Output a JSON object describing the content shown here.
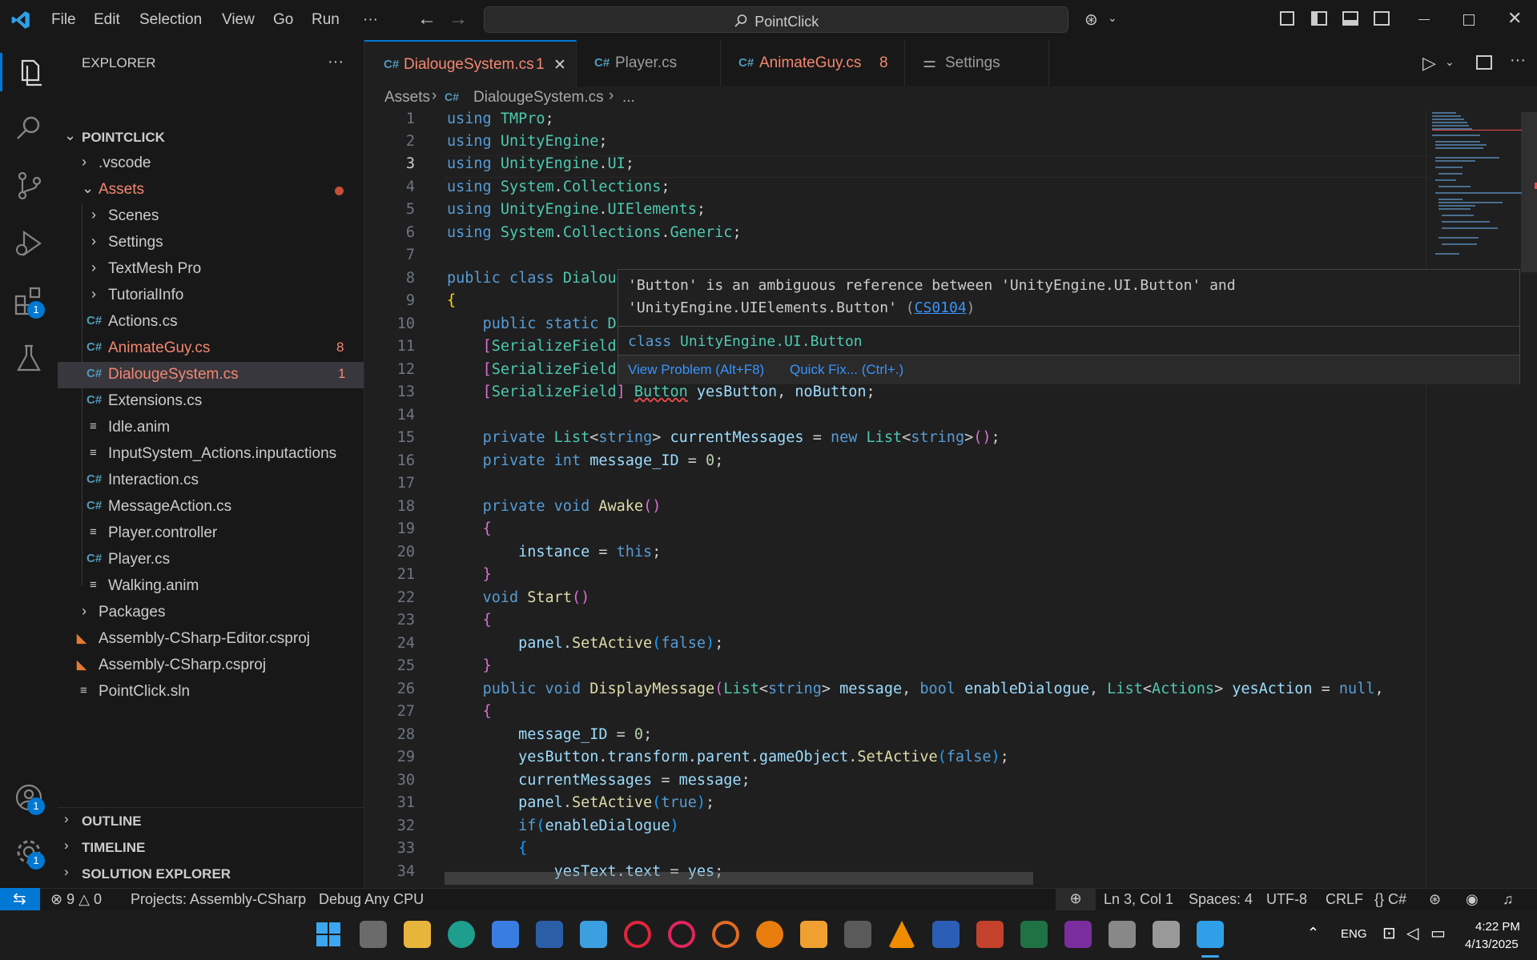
{
  "titlebar": {
    "menu": [
      "File",
      "Edit",
      "Selection",
      "View",
      "Go",
      "Run",
      "···"
    ],
    "search_text": "PointClick"
  },
  "activitybar": {
    "extensions_badge": "1",
    "accounts_badge": "1",
    "manage_badge": "1"
  },
  "explorer": {
    "title": "EXPLORER",
    "more": "···",
    "root": "POINTCLICK",
    "items": [
      {
        "label": ".vscode"
      },
      {
        "label": "Assets"
      },
      {
        "label": "Scenes"
      },
      {
        "label": "Settings"
      },
      {
        "label": "TextMesh Pro"
      },
      {
        "label": "TutorialInfo"
      },
      {
        "label": "Actions.cs"
      },
      {
        "label": "AnimateGuy.cs",
        "count": "8"
      },
      {
        "label": "DialougeSystem.cs",
        "count": "1"
      },
      {
        "label": "Extensions.cs"
      },
      {
        "label": "Idle.anim"
      },
      {
        "label": "InputSystem_Actions.inputactions"
      },
      {
        "label": "Interaction.cs"
      },
      {
        "label": "MessageAction.cs"
      },
      {
        "label": "Player.controller"
      },
      {
        "label": "Player.cs"
      },
      {
        "label": "Walking.anim"
      },
      {
        "label": "Packages"
      },
      {
        "label": "Assembly-CSharp-Editor.csproj"
      },
      {
        "label": "Assembly-CSharp.csproj"
      },
      {
        "label": "PointClick.sln"
      }
    ],
    "sections": [
      "OUTLINE",
      "TIMELINE",
      "SOLUTION EXPLORER"
    ]
  },
  "tabs": [
    {
      "label": "DialougeSystem.cs",
      "count": "1",
      "close": "✕"
    },
    {
      "label": "Player.cs"
    },
    {
      "label": "AnimateGuy.cs",
      "count": "8"
    },
    {
      "label": "Settings"
    }
  ],
  "breadcrumb": {
    "folder": "Assets",
    "file": "DialougeSystem.cs",
    "more": "..."
  },
  "hover": {
    "message_1": "'Button' is an ambiguous reference between 'UnityEngine.UI.Button' and",
    "message_2": "'UnityEngine.UIElements.Button'",
    "code": "CS0104",
    "class_kw": "class",
    "class_ns": "UnityEngine.UI.",
    "class_name": "Button",
    "view_problem": "View Problem (Alt+F8)",
    "quick_fix": "Quick Fix... (Ctrl+.)"
  },
  "status": {
    "errors": "9",
    "warnings": "0",
    "projects": "Projects: Assembly-CSharp",
    "debug": "Debug Any CPU",
    "position": "Ln 3, Col 1",
    "spaces": "Spaces: 4",
    "encoding": "UTF-8",
    "eol": "CRLF",
    "language": "C#"
  },
  "taskbar": {
    "lang": "ENG",
    "time": "4:22 PM",
    "date": "4/13/2025"
  },
  "colors": {
    "accent": "#0078d4",
    "error_file": "#f48771",
    "modified_dot": "#c74e39"
  }
}
